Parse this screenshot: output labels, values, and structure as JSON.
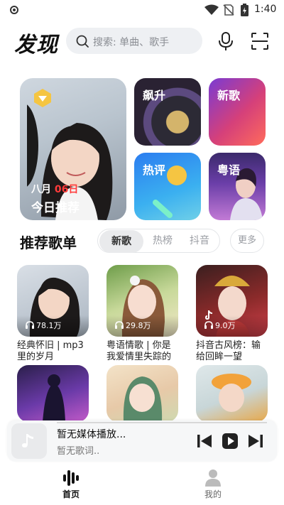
{
  "status_bar": {
    "time": "1:40"
  },
  "header": {
    "title": "发现",
    "search_placeholder": "搜索: 单曲、歌手"
  },
  "hero": {
    "date_prefix": "八月",
    "date_day": "06日",
    "title": "今日推荐"
  },
  "tiles": [
    {
      "label": "飙升"
    },
    {
      "label": "新歌"
    },
    {
      "label": "热评"
    },
    {
      "label": "粤语"
    }
  ],
  "section": {
    "title": "推荐歌单",
    "tabs": [
      "新歌",
      "热榜",
      "抖音"
    ],
    "active_tab": "新歌",
    "more_label": "更多"
  },
  "playlists": [
    {
      "name": "经典怀旧 | mp3里的岁月",
      "play_count": "78.1万"
    },
    {
      "name": "粤语情歌 | 你是我爱情里失踪的",
      "play_count": "29.8万"
    },
    {
      "name": "抖音古风榜：输给回眸一望",
      "play_count": "9.0万"
    },
    {
      "name": "",
      "play_count": ""
    },
    {
      "name": "",
      "play_count": ""
    },
    {
      "name": "",
      "play_count": ""
    }
  ],
  "player": {
    "title": "暂无媒体播放...",
    "lyrics": "暂无歌词.."
  },
  "nav": {
    "home_label": "首页",
    "me_label": "我的"
  },
  "colors": {
    "accent_date": "#ff3b3b",
    "nav_active": "#111111"
  }
}
